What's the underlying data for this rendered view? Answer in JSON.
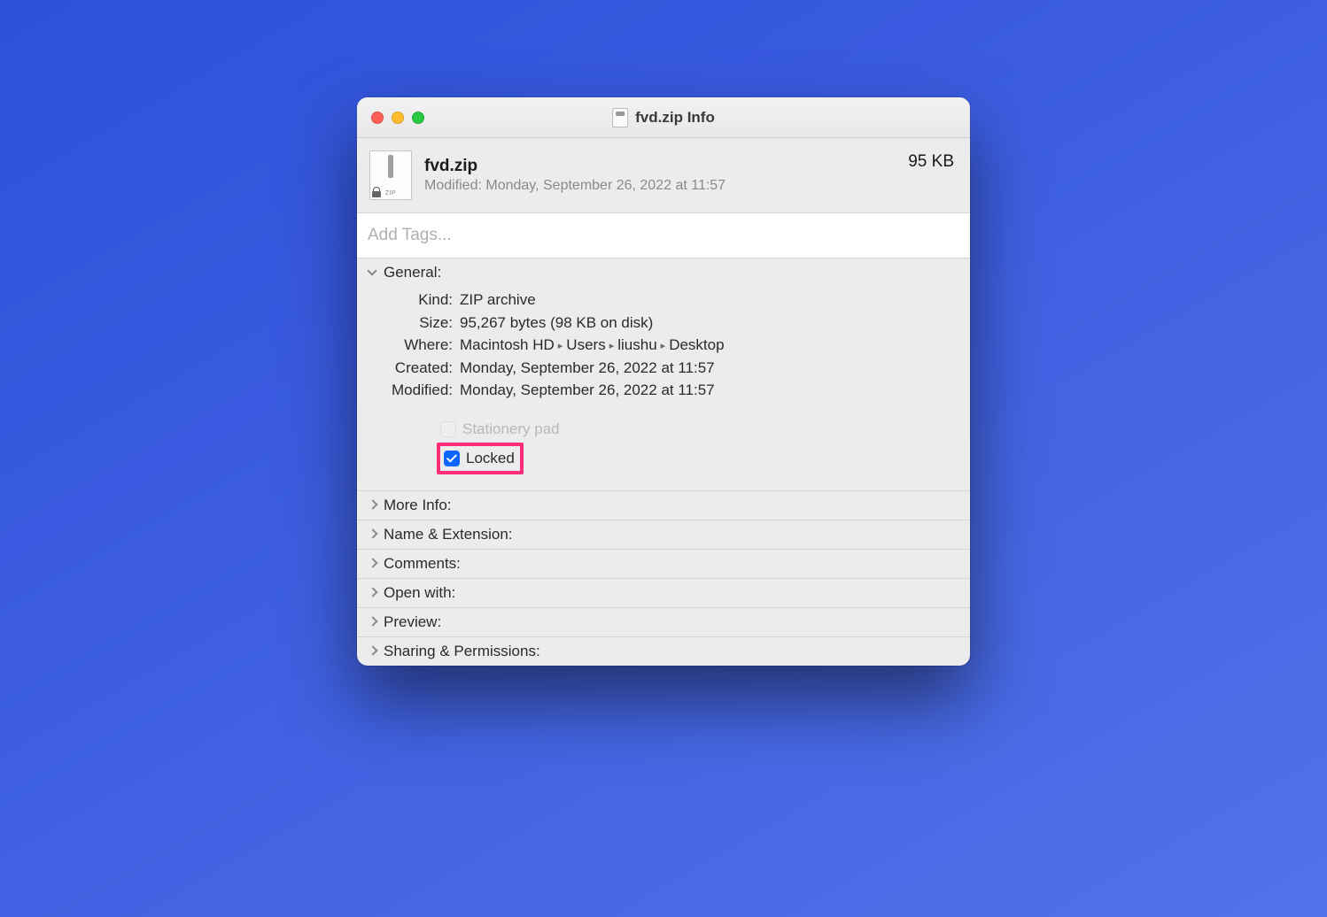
{
  "window": {
    "title": "fvd.zip Info"
  },
  "header": {
    "filename": "fvd.zip",
    "modified_label": "Modified:",
    "modified_value": "Monday, September 26, 2022 at 11:57",
    "size_display": "95 KB"
  },
  "tags": {
    "placeholder": "Add Tags..."
  },
  "sections": {
    "general": {
      "title": "General:",
      "kind_label": "Kind:",
      "kind_value": "ZIP archive",
      "size_label": "Size:",
      "size_value": "95,267 bytes (98 KB on disk)",
      "where_label": "Where:",
      "where_path": [
        "Macintosh HD",
        "Users",
        "liushu",
        "Desktop"
      ],
      "created_label": "Created:",
      "created_value": "Monday, September 26, 2022 at 11:57",
      "modified_label": "Modified:",
      "modified_value": "Monday, September 26, 2022 at 11:57",
      "stationery_label": "Stationery pad",
      "stationery_checked": false,
      "stationery_enabled": false,
      "locked_label": "Locked",
      "locked_checked": true
    },
    "more_info": "More Info:",
    "name_ext": "Name & Extension:",
    "comments": "Comments:",
    "open_with": "Open with:",
    "preview": "Preview:",
    "sharing": "Sharing & Permissions:"
  },
  "highlight": {
    "target": "locked-checkbox-row",
    "color": "#ff2d7a"
  }
}
